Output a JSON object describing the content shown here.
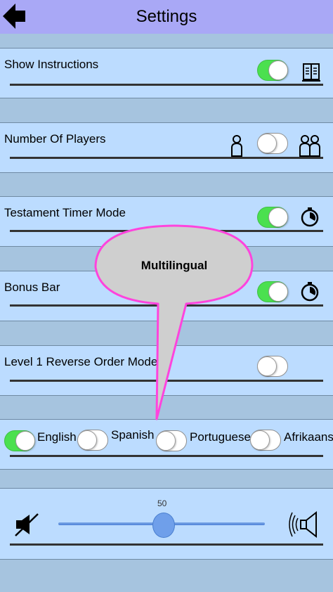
{
  "header": {
    "title": "Settings",
    "back_icon": "back-arrow-icon"
  },
  "settings": [
    {
      "label": "Show Instructions",
      "toggle": "on",
      "icon": "book-icon"
    },
    {
      "label": "Number Of Players",
      "toggle": "off",
      "left_icon": "single-player-icon",
      "right_icon": "two-players-icon"
    },
    {
      "label": "Testament Timer Mode",
      "toggle": "on",
      "icon": "timer-icon"
    },
    {
      "label": "Bonus Bar",
      "toggle": "on",
      "icon": "timer-icon"
    },
    {
      "label": "Level 1 Reverse Order Mode",
      "toggle": "off"
    }
  ],
  "languages": [
    {
      "label": "English",
      "selected": true
    },
    {
      "label": "Spanish",
      "selected": false
    },
    {
      "label": "Portuguese",
      "selected": false
    },
    {
      "label": "Afrikaans",
      "selected": false
    }
  ],
  "volume": {
    "value": "50",
    "level": 0.5,
    "mute_icon": "mute-icon",
    "speaker_icon": "speaker-icon"
  },
  "callout": {
    "text": "Multilingual",
    "color": "#ff44dd"
  },
  "colors": {
    "header": "#a9a8f6",
    "row": "#bcdcff",
    "toggle_on": "#4be04f"
  }
}
